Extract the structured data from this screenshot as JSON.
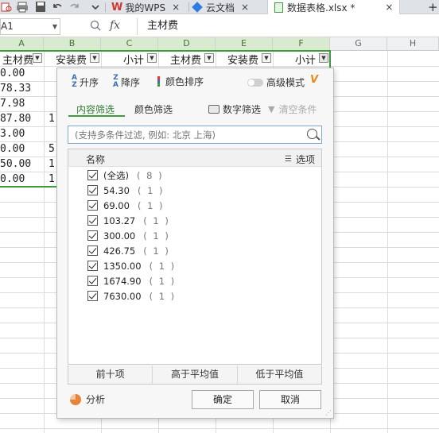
{
  "titlebar": {
    "tabs": [
      {
        "label": "我的WPS",
        "icon": "wps-logo-icon"
      },
      {
        "label": "云文档",
        "icon": "cloud-doc-icon"
      },
      {
        "label": "数据表格.xlsx *",
        "icon": "spreadsheet-icon"
      }
    ],
    "close_glyph": "×",
    "add_glyph": "+"
  },
  "formula_bar": {
    "name_box": "A1",
    "fx": "fx",
    "content": "主材费"
  },
  "columns": [
    "A",
    "B",
    "C",
    "D",
    "E",
    "F",
    "G",
    "H"
  ],
  "header_row": [
    "主材费",
    "安装费",
    "小计",
    "主材费",
    "安装费",
    "小计"
  ],
  "visible_cells": {
    "col_a": [
      "0.00",
      "78.33",
      "7.98",
      "87.80",
      "3.00",
      "0.00",
      "50.00",
      "0.00"
    ],
    "col_b": [
      "",
      "",
      "",
      "1",
      "",
      "5",
      "1",
      "1"
    ]
  },
  "filter_popup": {
    "sort_asc": "升序",
    "sort_desc": "降序",
    "sort_color": "颜色排序",
    "advanced_mode": "高级模式",
    "advanced_mode_on": false,
    "tab_content": "内容筛选",
    "tab_color": "颜色筛选",
    "number_filter": "数字筛选",
    "clear_filter": "清空条件",
    "search_placeholder": "(支持多条件过滤, 例如: 北京 上海)",
    "list_header_name": "名称",
    "list_header_options": "选项",
    "items": [
      {
        "label": "(全选)",
        "count": "( 8 )",
        "checked": true
      },
      {
        "label": "54.30",
        "count": "( 1 )",
        "checked": true
      },
      {
        "label": "69.00",
        "count": "( 1 )",
        "checked": true
      },
      {
        "label": "103.27",
        "count": "( 1 )",
        "checked": true
      },
      {
        "label": "300.00",
        "count": "( 1 )",
        "checked": true
      },
      {
        "label": "426.75",
        "count": "( 1 )",
        "checked": true
      },
      {
        "label": "1350.00",
        "count": "( 1 )",
        "checked": true
      },
      {
        "label": "1674.90",
        "count": "( 1 )",
        "checked": true
      },
      {
        "label": "7630.00",
        "count": "( 1 )",
        "checked": true
      }
    ],
    "quick_top10": "前十项",
    "quick_above_avg": "高于平均值",
    "quick_below_avg": "低于平均值",
    "analyze": "分析",
    "ok": "确定",
    "cancel": "取消"
  },
  "accent_color": "#3f9a3a"
}
